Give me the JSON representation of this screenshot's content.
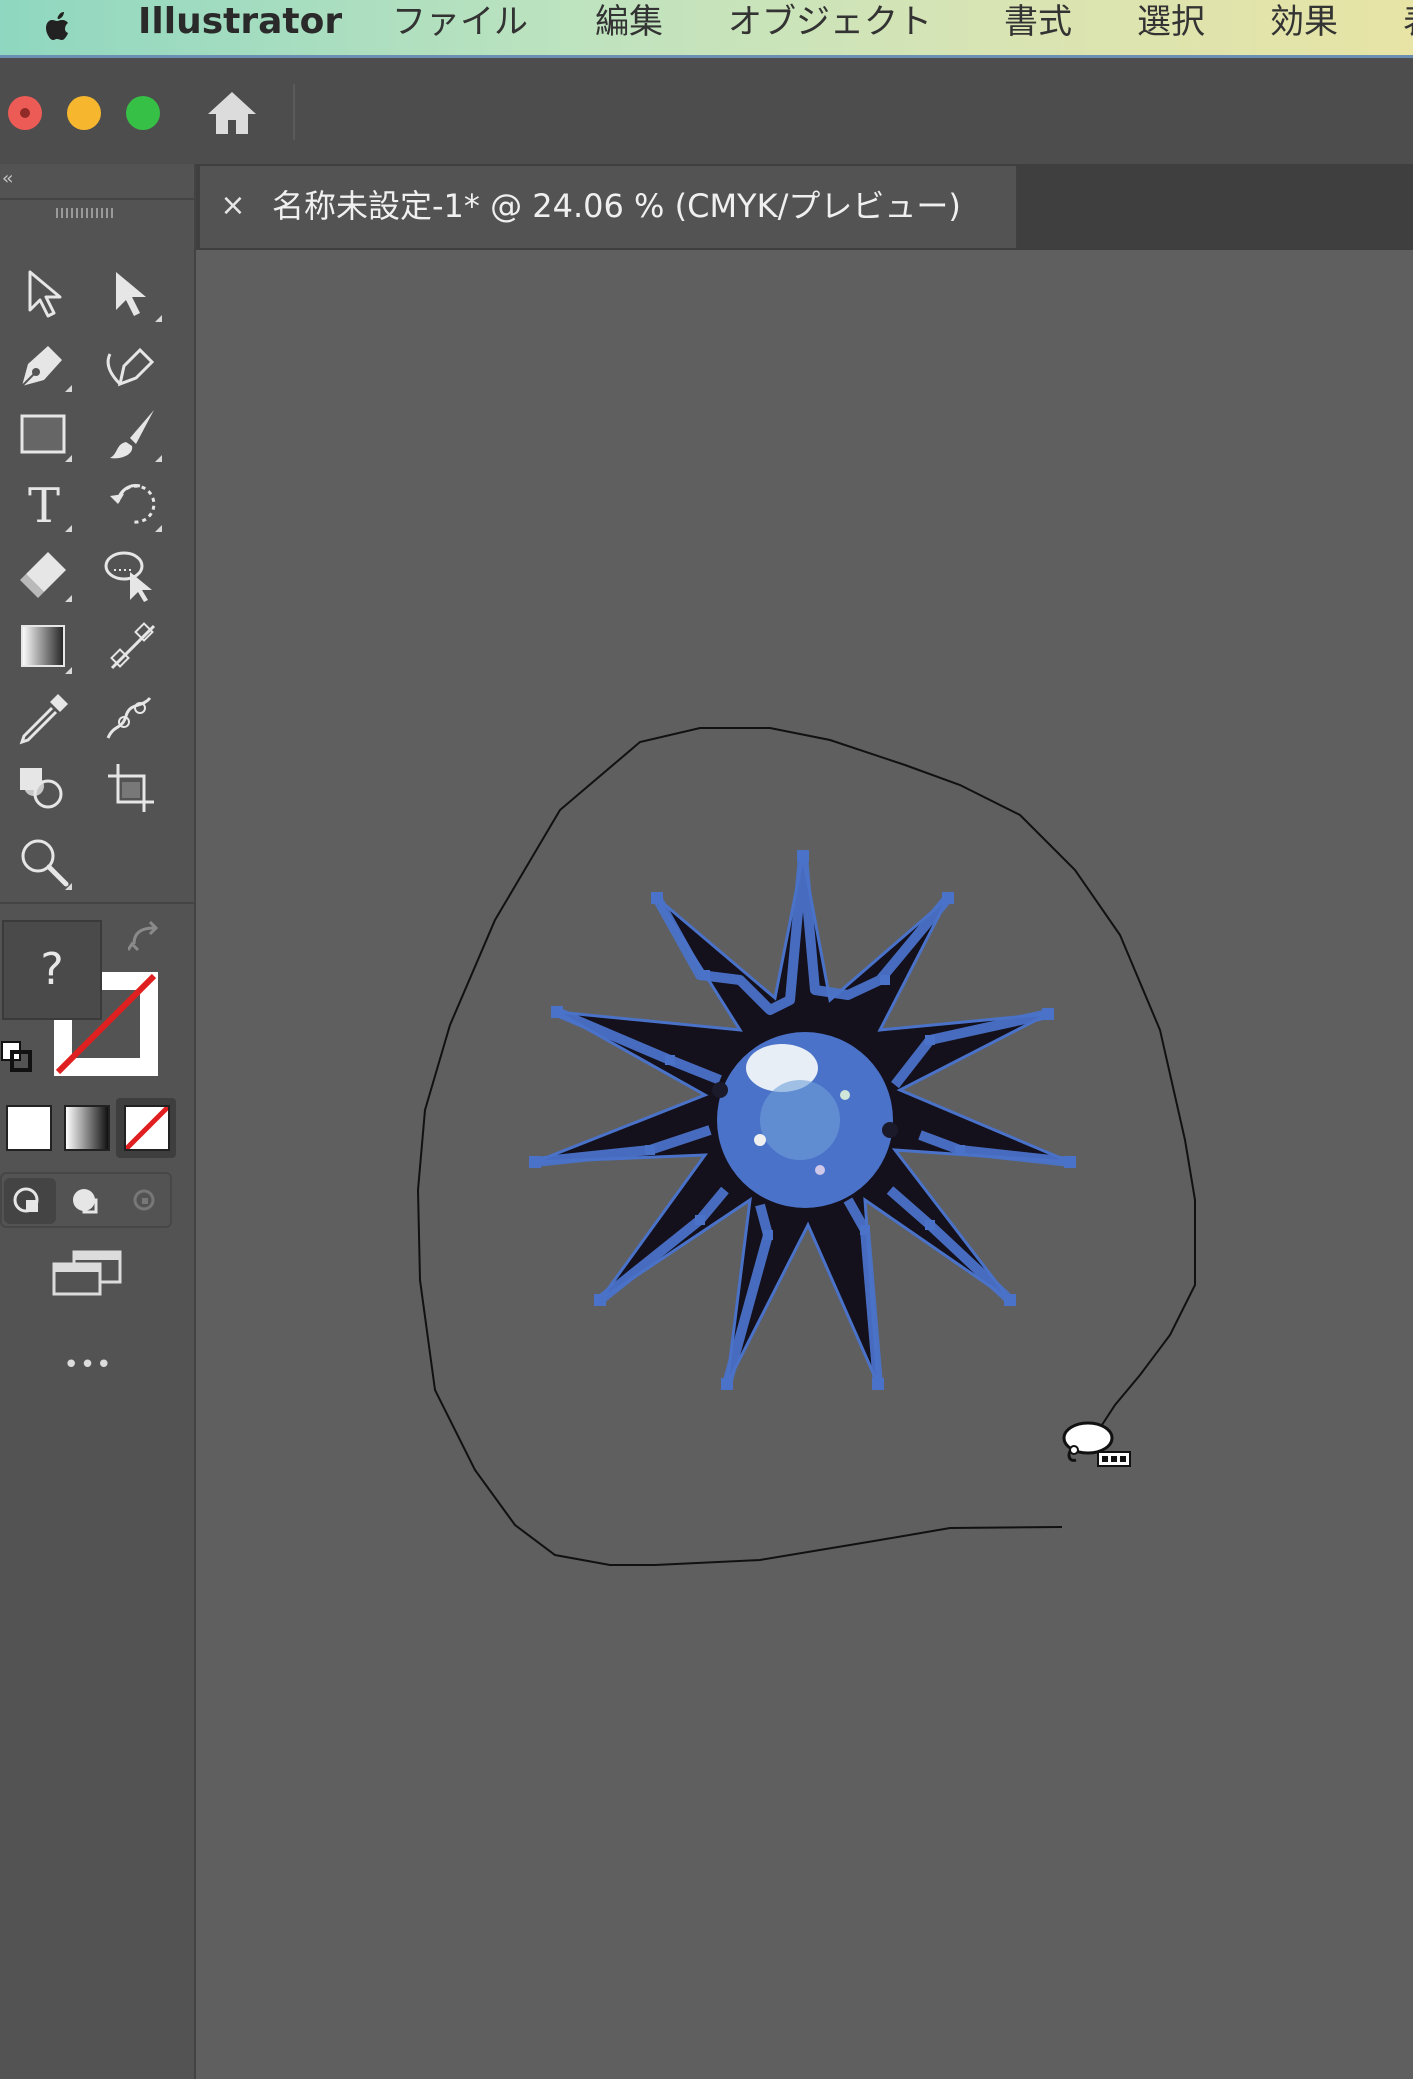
{
  "menubar": {
    "app_name": "Illustrator",
    "items": [
      {
        "label": "ファイル"
      },
      {
        "label": "編集"
      },
      {
        "label": "オブジェクト"
      },
      {
        "label": "書式"
      },
      {
        "label": "選択"
      },
      {
        "label": "効果"
      },
      {
        "label": "表"
      }
    ]
  },
  "document_tab": {
    "close_label": "×",
    "title": "名称未設定-1* @ 24.06 % (CMYK/プレビュー)"
  },
  "tools": [
    {
      "icon": "selection-tool-icon"
    },
    {
      "icon": "direct-selection-tool-icon"
    },
    {
      "icon": "pen-tool-icon"
    },
    {
      "icon": "curvature-tool-icon"
    },
    {
      "icon": "rectangle-tool-icon"
    },
    {
      "icon": "paintbrush-tool-icon"
    },
    {
      "icon": "type-tool-icon",
      "label": "T"
    },
    {
      "icon": "rotate-tool-icon"
    },
    {
      "icon": "eraser-tool-icon"
    },
    {
      "icon": "lasso-tool-icon"
    },
    {
      "icon": "gradient-tool-icon"
    },
    {
      "icon": "blend-tool-icon"
    },
    {
      "icon": "eyedropper-tool-icon"
    },
    {
      "icon": "puppet-warp-tool-icon"
    },
    {
      "icon": "shape-builder-tool-icon"
    },
    {
      "icon": "artboard-tool-icon"
    },
    {
      "icon": "zoom-tool-icon"
    }
  ],
  "fill_stroke": {
    "fill_label": "?",
    "swap_icon": "swap-arrow-icon",
    "default_icon": "default-fill-stroke-icon"
  },
  "more_tools_label": "•••",
  "colors": {
    "selection_blue": "#4a72c8",
    "canvas": "#5f5f5f",
    "panel": "#535353",
    "none_red": "#e02020"
  },
  "cursor": {
    "icon": "lasso-cursor-icon"
  }
}
